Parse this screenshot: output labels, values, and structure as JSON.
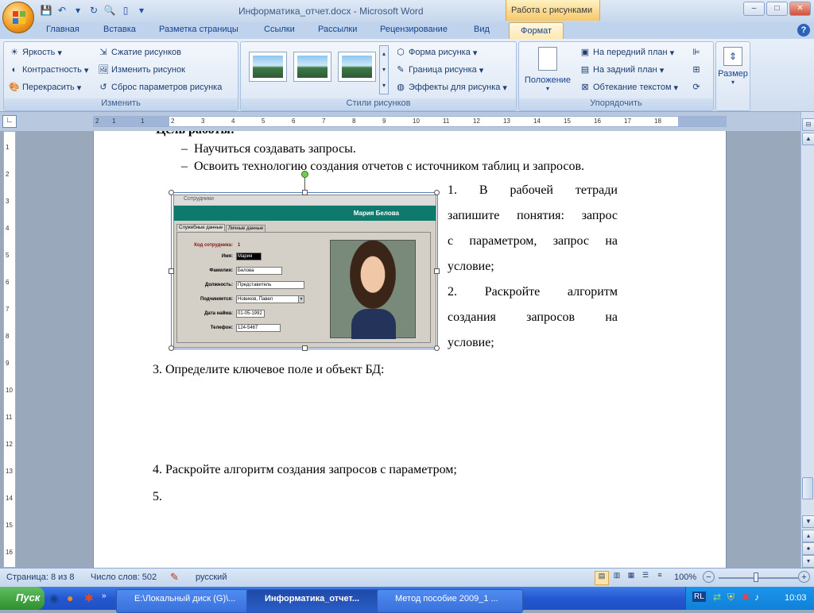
{
  "window": {
    "title": "Информатика_отчет.docx - Microsoft Word",
    "context_header": "Работа с рисунками",
    "buttons": {
      "minimize": "‒",
      "maximize": "□",
      "close": "✕"
    }
  },
  "tabs": [
    "Главная",
    "Вставка",
    "Разметка страницы",
    "Ссылки",
    "Рассылки",
    "Рецензирование",
    "Вид",
    "Формат"
  ],
  "ribbon": {
    "adjust": {
      "label": "Изменить",
      "items": [
        "Яркость",
        "Контрастность",
        "Перекрасить",
        "Сжатие рисунков",
        "Изменить рисунок",
        "Сброс параметров рисунка"
      ]
    },
    "styles": {
      "label": "Стили рисунков",
      "items": [
        "Форма рисунка",
        "Граница рисунка",
        "Эффекты для рисунка"
      ]
    },
    "arrange": {
      "label": "Упорядочить",
      "position": "Положение",
      "items": [
        "На передний план",
        "На задний план",
        "Обтекание текстом"
      ]
    },
    "size": {
      "label": "Размер"
    }
  },
  "ruler": {
    "h_ticks": [
      "2",
      "1",
      "1",
      "2",
      "3",
      "4",
      "5",
      "6",
      "7",
      "8",
      "9",
      "10",
      "11",
      "12",
      "13",
      "14",
      "15",
      "16",
      "17",
      "18"
    ],
    "v_ticks": [
      "1",
      "2",
      "3",
      "4",
      "5",
      "6",
      "7",
      "8",
      "9",
      "10",
      "11",
      "12",
      "13",
      "14",
      "15",
      "16"
    ]
  },
  "document": {
    "heading_partial": "Цель работы:",
    "bullets": [
      "Научиться создавать запросы.",
      "Освоить технологию создания отчетов с источником таблиц и запросов."
    ],
    "wrap_lines": [
      [
        "1.",
        "В",
        "рабочей",
        "тетради"
      ],
      [
        "запишите",
        "понятия:",
        "запрос"
      ],
      [
        "с",
        "параметром,",
        "запрос",
        "на"
      ],
      [
        "условие;"
      ],
      [
        "2.",
        "Раскройте",
        "алгоритм"
      ],
      [
        "создания",
        "запросов",
        "на"
      ],
      [
        "условие;"
      ]
    ],
    "item3": "3.  Определите ключевое поле и объект БД:",
    "item4": "4.  Раскройте алгоритм создания запросов с параметром;",
    "item5": "5."
  },
  "form_image": {
    "title": "Сотрудники",
    "header_name": "Мария Белова",
    "tabs": [
      "Служебные данные",
      "Личные данные"
    ],
    "fields": [
      {
        "label": "Код сотрудника:",
        "value": "1"
      },
      {
        "label": "Имя:",
        "value": "Мария"
      },
      {
        "label": "Фамилия:",
        "value": "Белова"
      },
      {
        "label": "Должность:",
        "value": "Представитель"
      },
      {
        "label": "Подчиняется:",
        "value": "Новиков, Павел"
      },
      {
        "label": "Дата найма:",
        "value": "01-05-1992"
      },
      {
        "label": "Телефон:",
        "value": "124-5467"
      }
    ]
  },
  "status": {
    "page": "Страница: 8 из 8",
    "words": "Число слов: 502",
    "lang": "русский",
    "zoom": "100%"
  },
  "taskbar": {
    "start": "Пуск",
    "tasks": [
      "E:\\Локальный диск (G)\\...",
      "Информатика_отчет...",
      "Метод пособие 2009_1 ..."
    ],
    "lang": "RL",
    "clock": "10:03"
  }
}
